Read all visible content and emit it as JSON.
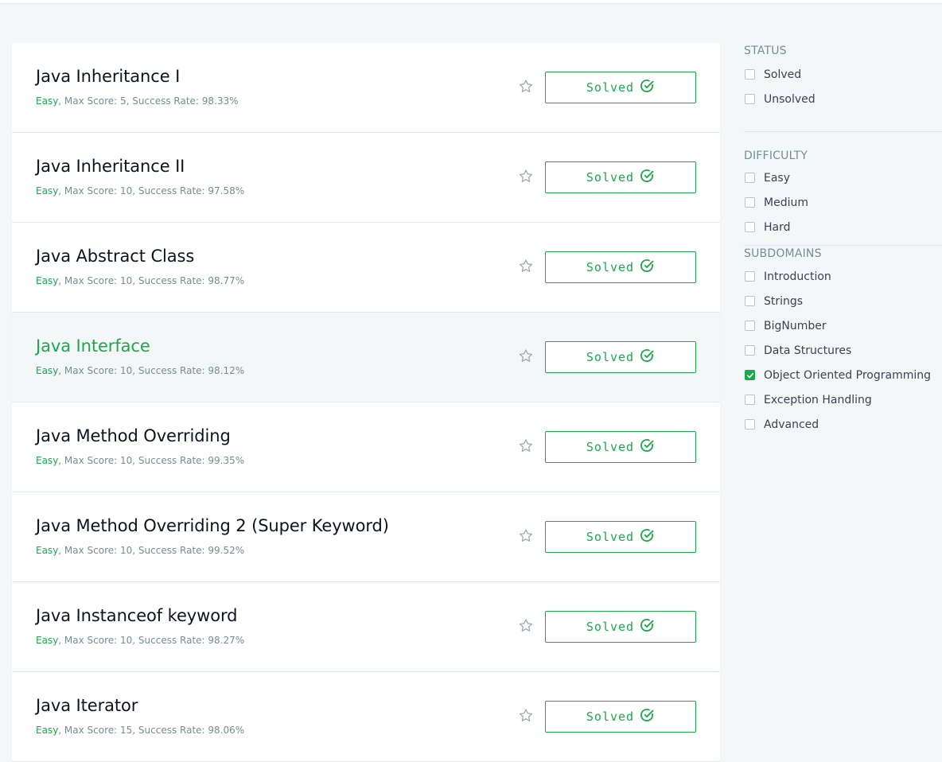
{
  "challenges": [
    {
      "title": "Java Inheritance I",
      "difficulty": "Easy",
      "meta": ", Max Score: 5, Success Rate: 98.33%",
      "status": "Solved"
    },
    {
      "title": "Java Inheritance II",
      "difficulty": "Easy",
      "meta": ", Max Score: 10, Success Rate: 97.58%",
      "status": "Solved"
    },
    {
      "title": "Java Abstract Class",
      "difficulty": "Easy",
      "meta": ", Max Score: 10, Success Rate: 98.77%",
      "status": "Solved"
    },
    {
      "title": "Java Interface",
      "difficulty": "Easy",
      "meta": ", Max Score: 10, Success Rate: 98.12%",
      "status": "Solved"
    },
    {
      "title": "Java Method Overriding",
      "difficulty": "Easy",
      "meta": ", Max Score: 10, Success Rate: 99.35%",
      "status": "Solved"
    },
    {
      "title": "Java Method Overriding 2 (Super Keyword)",
      "difficulty": "Easy",
      "meta": ", Max Score: 10, Success Rate: 99.52%",
      "status": "Solved"
    },
    {
      "title": "Java Instanceof keyword",
      "difficulty": "Easy",
      "meta": ", Max Score: 10, Success Rate: 98.27%",
      "status": "Solved"
    },
    {
      "title": "Java Iterator",
      "difficulty": "Easy",
      "meta": ", Max Score: 15, Success Rate: 98.06%",
      "status": "Solved"
    }
  ],
  "filters": {
    "status": {
      "title": "STATUS",
      "items": [
        "Solved",
        "Unsolved"
      ]
    },
    "difficulty": {
      "title": "DIFFICULTY",
      "items": [
        "Easy",
        "Medium",
        "Hard"
      ]
    },
    "subdomains": {
      "title": "SUBDOMAINS",
      "items": [
        "Introduction",
        "Strings",
        "BigNumber",
        "Data Structures",
        "Object Oriented Programming",
        "Exception Handling",
        "Advanced"
      ],
      "checked": "Object Oriented Programming"
    }
  },
  "colors": {
    "accent": "#1ba94c",
    "muted": "#738f93",
    "title": "#0e141e"
  },
  "icons": {
    "star": "star-icon",
    "solved": "check-circle-icon",
    "checkbox": "checkbox-icon"
  }
}
